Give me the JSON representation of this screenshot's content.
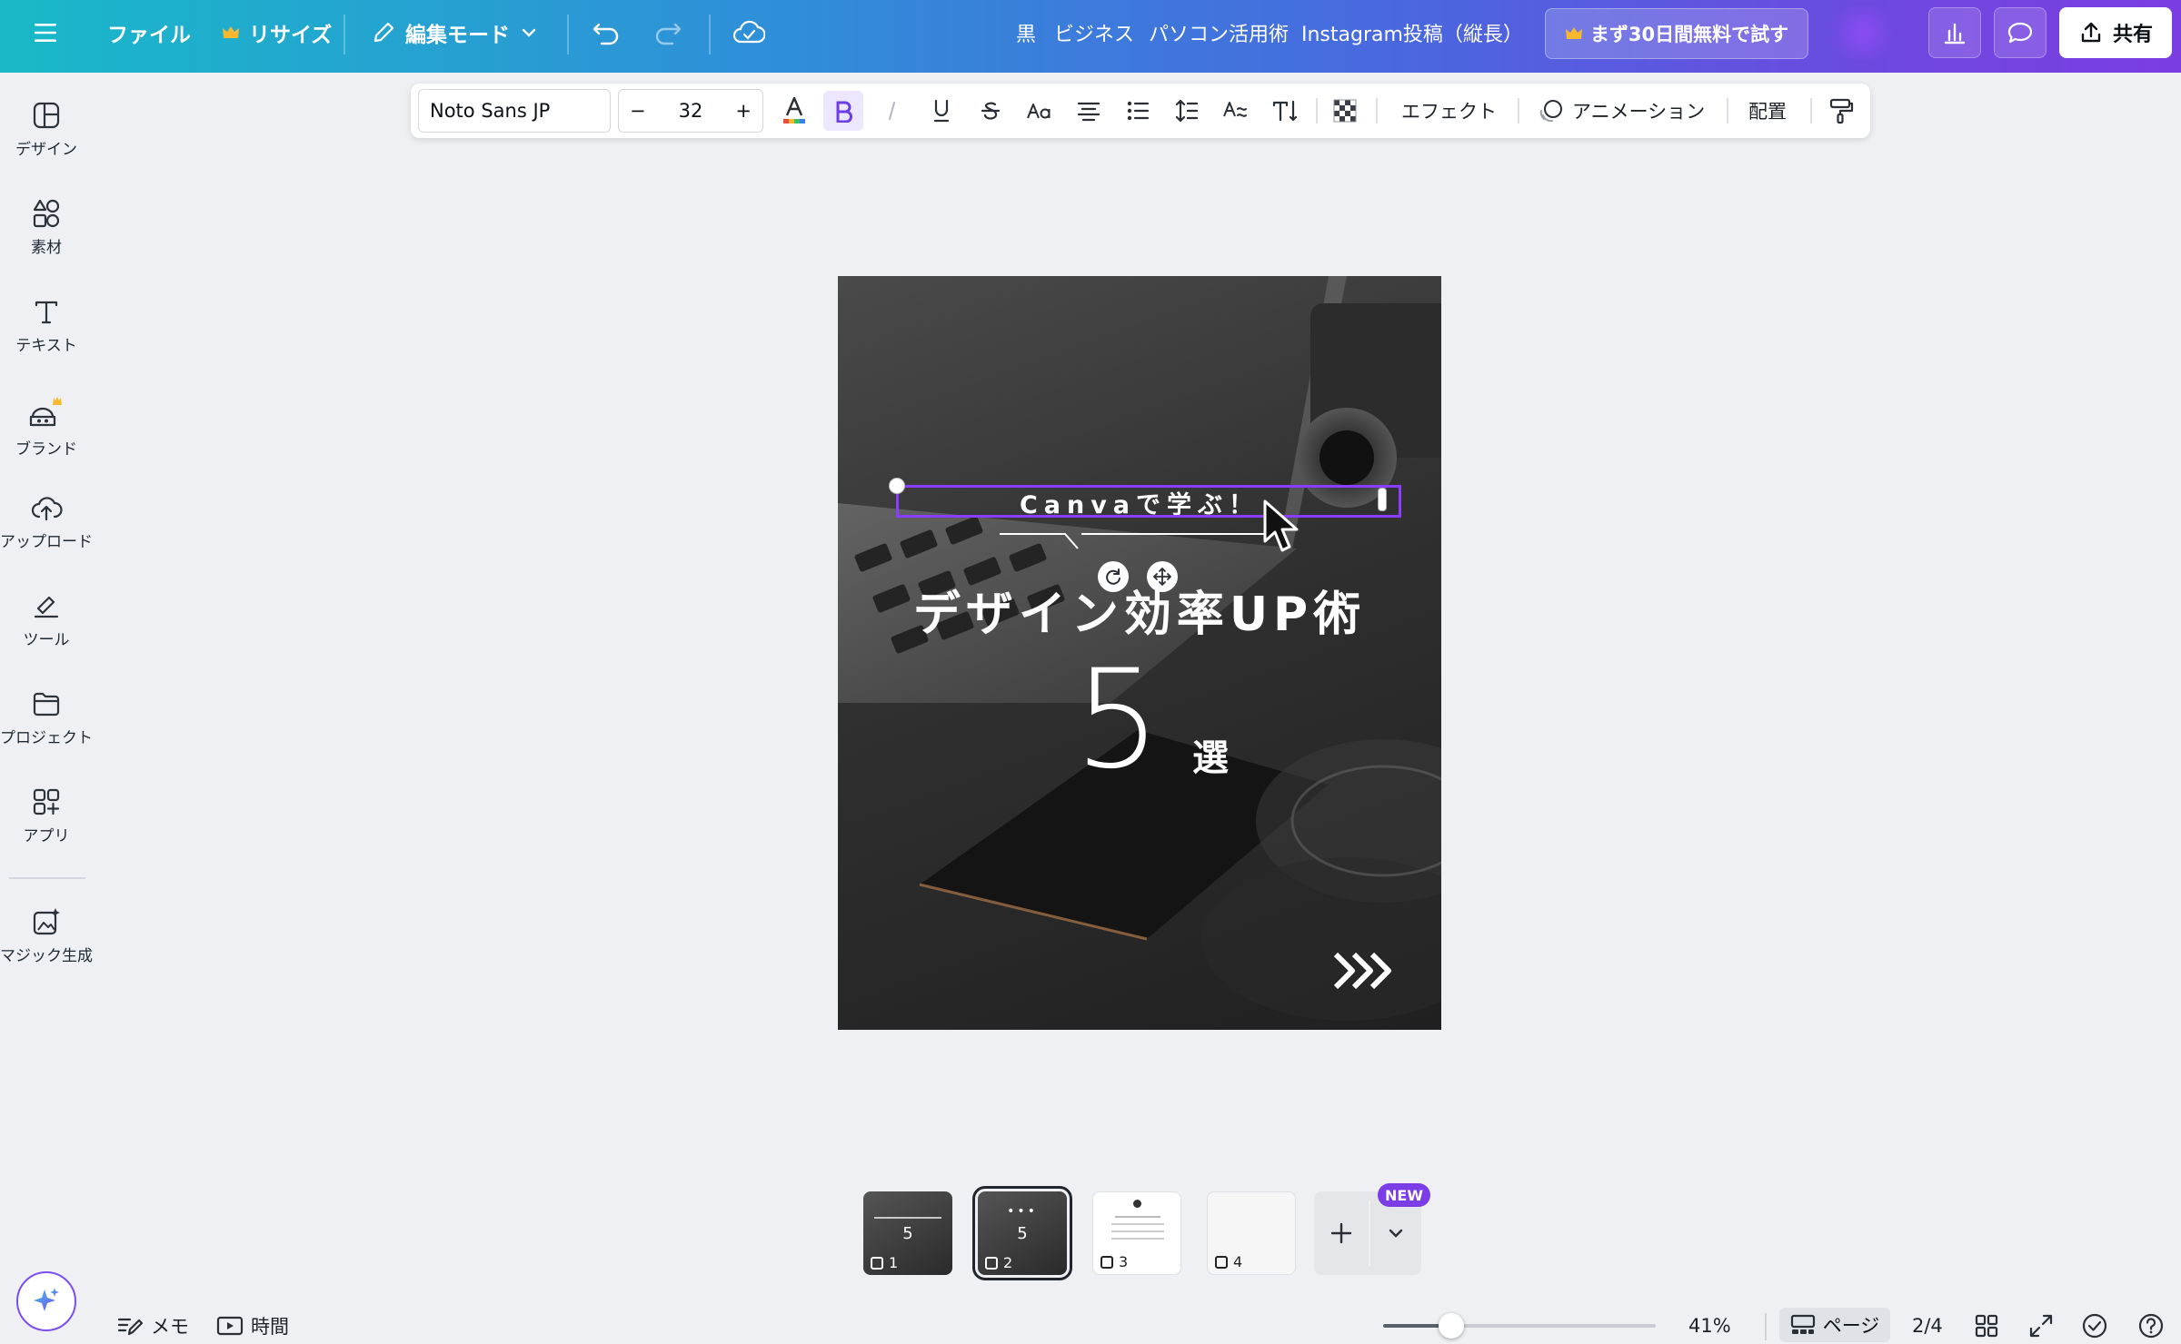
{
  "topbar": {
    "menu_label": "",
    "file": "ファイル",
    "resize": "リサイズ",
    "edit_mode": "編集モード",
    "tags": [
      "黒",
      "ビジネス",
      "パソコン活用術",
      "Instagram投稿（縦長）"
    ],
    "trial": "まず30日間無料で試す",
    "share": "共有"
  },
  "sidebar": {
    "items": [
      {
        "label": "デザイン",
        "icon": "design-icon"
      },
      {
        "label": "素材",
        "icon": "elements-icon"
      },
      {
        "label": "テキスト",
        "icon": "text-icon"
      },
      {
        "label": "ブランド",
        "icon": "brand-icon"
      },
      {
        "label": "アップロード",
        "icon": "upload-icon"
      },
      {
        "label": "ツール",
        "icon": "tools-icon"
      },
      {
        "label": "プロジェクト",
        "icon": "projects-icon"
      },
      {
        "label": "アプリ",
        "icon": "apps-icon"
      },
      {
        "label": "マジック生成",
        "icon": "magic-media-icon"
      }
    ]
  },
  "text_toolbar": {
    "font": "Noto Sans JP",
    "size": "32",
    "minus": "−",
    "plus": "+",
    "effects": "エフェクト",
    "animate": "アニメーション",
    "position": "配置"
  },
  "design": {
    "subtitle": "Canvaで学ぶ！",
    "title": "デザイン効率UP術",
    "number": "5",
    "unit": "選",
    "arrows": "»»"
  },
  "pages": {
    "thumbs": [
      {
        "num": "1",
        "style": "dark"
      },
      {
        "num": "2",
        "style": "dark"
      },
      {
        "num": "3",
        "style": "light"
      },
      {
        "num": "4",
        "style": "blank"
      }
    ],
    "selected": 2,
    "new_badge": "NEW"
  },
  "bottom": {
    "notes": "メモ",
    "timer": "時間",
    "zoom": "41%",
    "zoom_fraction": 0.25,
    "pages_label": "ページ",
    "page_count": "2/4"
  },
  "colors": {
    "accent": "#8b3dff",
    "crown": "#f5b82e"
  }
}
